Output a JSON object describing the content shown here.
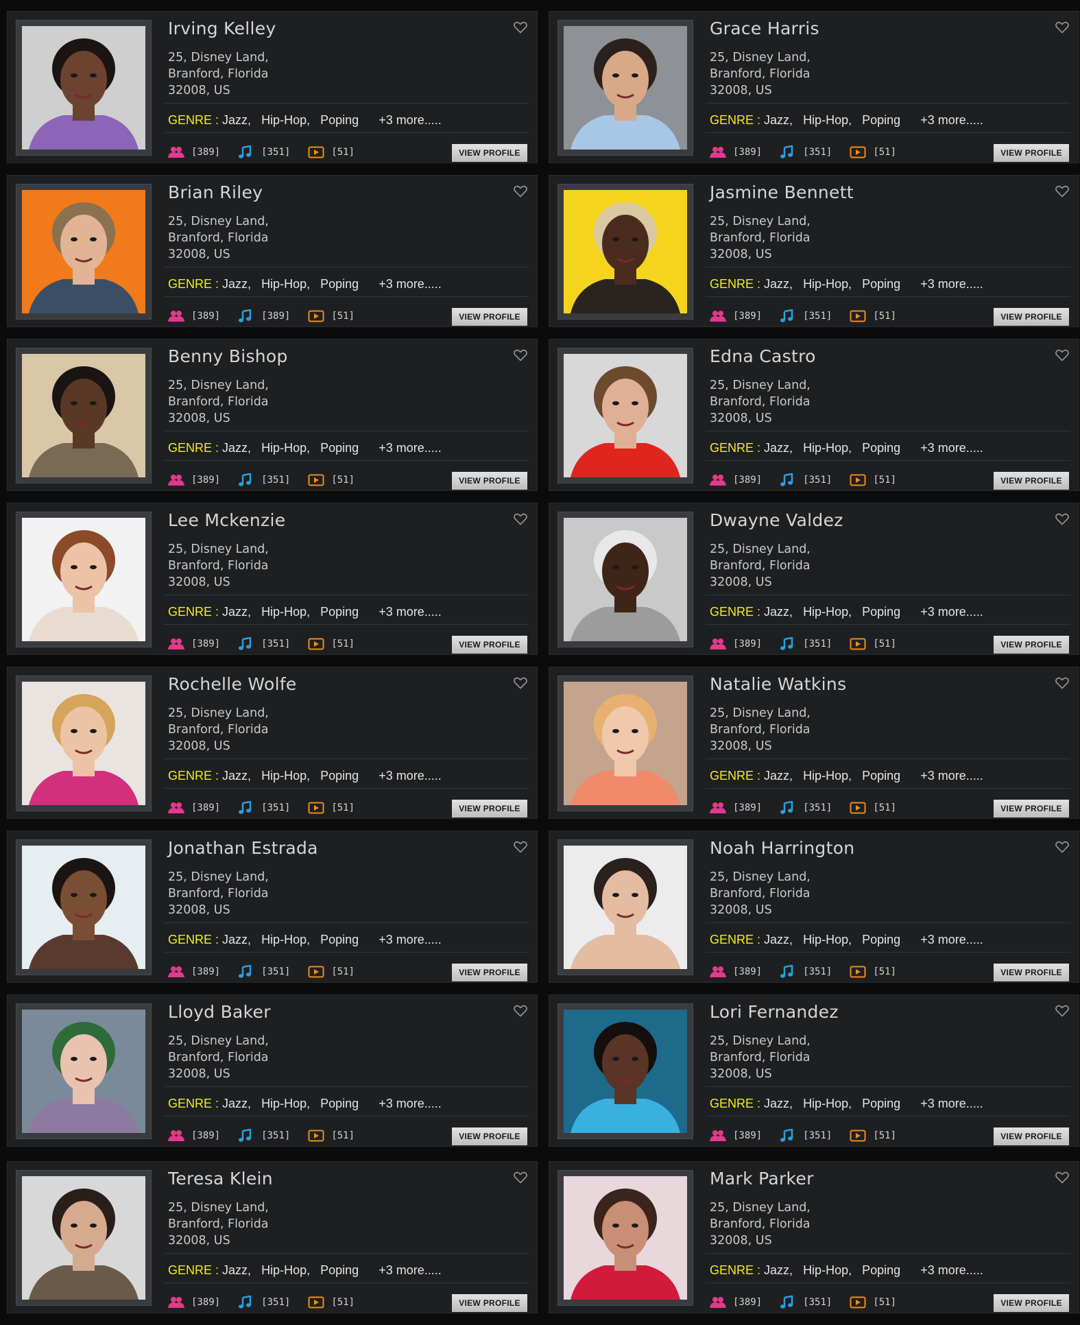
{
  "colors": {
    "page_bg": "#0b0b0b",
    "card_bg": "#1e1f21",
    "genre_label": "#f2ee1c",
    "fans_icon": "#e23a8c",
    "music_icon": "#27a1e0",
    "video_icon": "#ef8c1a"
  },
  "icons": {
    "favorite": "heart-outline-icon",
    "fans": "users-icon",
    "tracks": "music-note-icon",
    "videos": "video-play-icon"
  },
  "profiles": [
    {
      "name": "Irving Kelley",
      "address": [
        "25, Disney Land,",
        "Branford, Florida",
        "32008, US"
      ],
      "genre_label": "GENRE :",
      "genres": [
        "Jazz,",
        "Hip-Hop,",
        "Poping"
      ],
      "more": "+3 more.....",
      "fans": "[389]",
      "tracks": "[351]",
      "videos": "[51]",
      "button": "VIEW PROFILE",
      "photo_bg": "#cfcfcf",
      "skin": "#6b4330",
      "hair": "#1a1412",
      "shirt": "#8c64b8"
    },
    {
      "name": "Grace Harris",
      "address": [
        "25, Disney Land,",
        "Branford, Florida",
        "32008, US"
      ],
      "genre_label": "GENRE :",
      "genres": [
        "Jazz,",
        "Hip-Hop,",
        "Poping"
      ],
      "more": "+3 more.....",
      "fans": "[389]",
      "tracks": "[351]",
      "videos": "[51]",
      "button": "VIEW PROFILE",
      "photo_bg": "#8e9196",
      "skin": "#d9a889",
      "hair": "#2a211c",
      "shirt": "#a8c7e6"
    },
    {
      "name": "Brian Riley",
      "address": [
        "25, Disney Land,",
        "Branford, Florida",
        "32008, US"
      ],
      "genre_label": "GENRE :",
      "genres": [
        "Jazz,",
        "Hip-Hop,",
        "Poping"
      ],
      "more": "+3 more.....",
      "fans": "[389]",
      "tracks": "[389]",
      "videos": "[51]",
      "button": "VIEW PROFILE",
      "photo_bg": "#f27a1a",
      "skin": "#e2b394",
      "hair": "#8a7152",
      "shirt": "#3a4f66"
    },
    {
      "name": "Jasmine Bennett",
      "address": [
        "25, Disney Land,",
        "Branford, Florida",
        "32008, US"
      ],
      "genre_label": "GENRE :",
      "genres": [
        "Jazz,",
        "Hip-Hop,",
        "Poping"
      ],
      "more": "+3 more.....",
      "fans": "[389]",
      "tracks": "[351]",
      "videos": "[51]",
      "button": "VIEW PROFILE",
      "photo_bg": "#f5d41e",
      "skin": "#4a2c1e",
      "hair": "#d9c8a0",
      "shirt": "#2a2420"
    },
    {
      "name": "Benny Bishop",
      "address": [
        "25, Disney Land,",
        "Branford, Florida",
        "32008, US"
      ],
      "genre_label": "GENRE :",
      "genres": [
        "Jazz,",
        "Hip-Hop,",
        "Poping"
      ],
      "more": "+3 more.....",
      "fans": "[389]",
      "tracks": "[351]",
      "videos": "[51]",
      "button": "VIEW PROFILE",
      "photo_bg": "#d9c7a8",
      "skin": "#5a3826",
      "hair": "#1a1412",
      "shirt": "#7a6a55"
    },
    {
      "name": "Edna Castro",
      "address": [
        "25, Disney Land,",
        "Branford, Florida",
        "32008, US"
      ],
      "genre_label": "GENRE :",
      "genres": [
        "Jazz,",
        "Hip-Hop,",
        "Poping"
      ],
      "more": "+3 more.....",
      "fans": "[389]",
      "tracks": "[351]",
      "videos": "[51]",
      "button": "VIEW PROFILE",
      "photo_bg": "#d8d8d8",
      "skin": "#e0b096",
      "hair": "#6b4a2e",
      "shirt": "#e0251e"
    },
    {
      "name": "Lee Mckenzie",
      "address": [
        "25, Disney Land,",
        "Branford, Florida",
        "32008, US"
      ],
      "genre_label": "GENRE :",
      "genres": [
        "Jazz,",
        "Hip-Hop,",
        "Poping"
      ],
      "more": "+3 more.....",
      "fans": "[389]",
      "tracks": "[351]",
      "videos": "[51]",
      "button": "VIEW PROFILE",
      "photo_bg": "#f2f2f2",
      "skin": "#ecc3a6",
      "hair": "#8c4a28",
      "shirt": "#e8dcd0"
    },
    {
      "name": "Dwayne Valdez",
      "address": [
        "25, Disney Land,",
        "Branford, Florida",
        "32008, US"
      ],
      "genre_label": "GENRE :",
      "genres": [
        "Jazz,",
        "Hip-Hop,",
        "Poping"
      ],
      "more": "+3 more.....",
      "fans": "[389]",
      "tracks": "[351]",
      "videos": "[51]",
      "button": "VIEW PROFILE",
      "photo_bg": "#c9c9c9",
      "skin": "#3e2518",
      "hair": "#e8e8e8",
      "shirt": "#9c9c9c"
    },
    {
      "name": "Rochelle Wolfe",
      "address": [
        "25, Disney Land,",
        "Branford, Florida",
        "32008, US"
      ],
      "genre_label": "GENRE :",
      "genres": [
        "Jazz,",
        "Hip-Hop,",
        "Poping"
      ],
      "more": "+3 more.....",
      "fans": "[389]",
      "tracks": "[351]",
      "videos": "[51]",
      "button": "VIEW PROFILE",
      "photo_bg": "#e9e4df",
      "skin": "#edc3a6",
      "hair": "#d4a55a",
      "shirt": "#d2307c"
    },
    {
      "name": "Natalie Watkins",
      "address": [
        "25, Disney Land,",
        "Branford, Florida",
        "32008, US"
      ],
      "genre_label": "GENRE :",
      "genres": [
        "Jazz,",
        "Hip-Hop,",
        "Poping"
      ],
      "more": "+3 more.....",
      "fans": "[389]",
      "tracks": "[351]",
      "videos": "[51]",
      "button": "VIEW PROFILE",
      "photo_bg": "#c4a48c",
      "skin": "#f0c8ac",
      "hair": "#e8b070",
      "shirt": "#f08a6a"
    },
    {
      "name": "Jonathan Estrada",
      "address": [
        "25, Disney Land,",
        "Branford, Florida",
        "32008, US"
      ],
      "genre_label": "GENRE :",
      "genres": [
        "Jazz,",
        "Hip-Hop,",
        "Poping"
      ],
      "more": "+3 more.....",
      "fans": "[389]",
      "tracks": "[351]",
      "videos": "[51]",
      "button": "VIEW PROFILE",
      "photo_bg": "#e6eef2",
      "skin": "#7a4e34",
      "hair": "#1a1412",
      "shirt": "#5a3a2e"
    },
    {
      "name": "Noah Harrington",
      "address": [
        "25, Disney Land,",
        "Branford, Florida",
        "32008, US"
      ],
      "genre_label": "GENRE :",
      "genres": [
        "Jazz,",
        "Hip-Hop,",
        "Poping"
      ],
      "more": "+3 more.....",
      "fans": "[389]",
      "tracks": "[351]",
      "videos": "[51]",
      "button": "VIEW PROFILE",
      "photo_bg": "#ececec",
      "skin": "#e3bca2",
      "hair": "#2a211c",
      "shirt": "#e3bca2"
    },
    {
      "name": "Lloyd Baker",
      "address": [
        "25, Disney Land,",
        "Branford, Florida",
        "32008, US"
      ],
      "genre_label": "GENRE :",
      "genres": [
        "Jazz,",
        "Hip-Hop,",
        "Poping"
      ],
      "more": "+3 more.....",
      "fans": "[389]",
      "tracks": "[351]",
      "videos": "[51]",
      "button": "VIEW PROFILE",
      "photo_bg": "#7a8a9a",
      "skin": "#e9c2b0",
      "hair": "#2f6a3a",
      "shirt": "#8c7aa0"
    },
    {
      "name": "Lori Fernandez",
      "address": [
        "25, Disney Land,",
        "Branford, Florida",
        "32008, US"
      ],
      "genre_label": "GENRE :",
      "genres": [
        "Jazz,",
        "Hip-Hop,",
        "Poping"
      ],
      "more": "+3 more.....",
      "fans": "[389]",
      "tracks": "[351]",
      "videos": "[51]",
      "button": "VIEW PROFILE",
      "photo_bg": "#1e6a8a",
      "skin": "#5a3424",
      "hair": "#140e0c",
      "shirt": "#3ab0e0"
    },
    {
      "name": "Teresa Klein",
      "address": [
        "25, Disney Land,",
        "Branford, Florida",
        "32008, US"
      ],
      "genre_label": "GENRE :",
      "genres": [
        "Jazz,",
        "Hip-Hop,",
        "Poping"
      ],
      "more": "+3 more.....",
      "fans": "[389]",
      "tracks": "[351]",
      "videos": "[51]",
      "button": "VIEW PROFILE",
      "photo_bg": "#d8d8d8",
      "skin": "#d6aa8e",
      "hair": "#2a1e18",
      "shirt": "#6a5a4a"
    },
    {
      "name": "Mark Parker",
      "address": [
        "25, Disney Land,",
        "Branford, Florida",
        "32008, US"
      ],
      "genre_label": "GENRE :",
      "genres": [
        "Jazz,",
        "Hip-Hop,",
        "Poping"
      ],
      "more": "+3 more.....",
      "fans": "[389]",
      "tracks": "[351]",
      "videos": "[51]",
      "button": "VIEW PROFILE",
      "photo_bg": "#e8d8dc",
      "skin": "#c98e76",
      "hair": "#3a241c",
      "shirt": "#d21a3a"
    }
  ]
}
